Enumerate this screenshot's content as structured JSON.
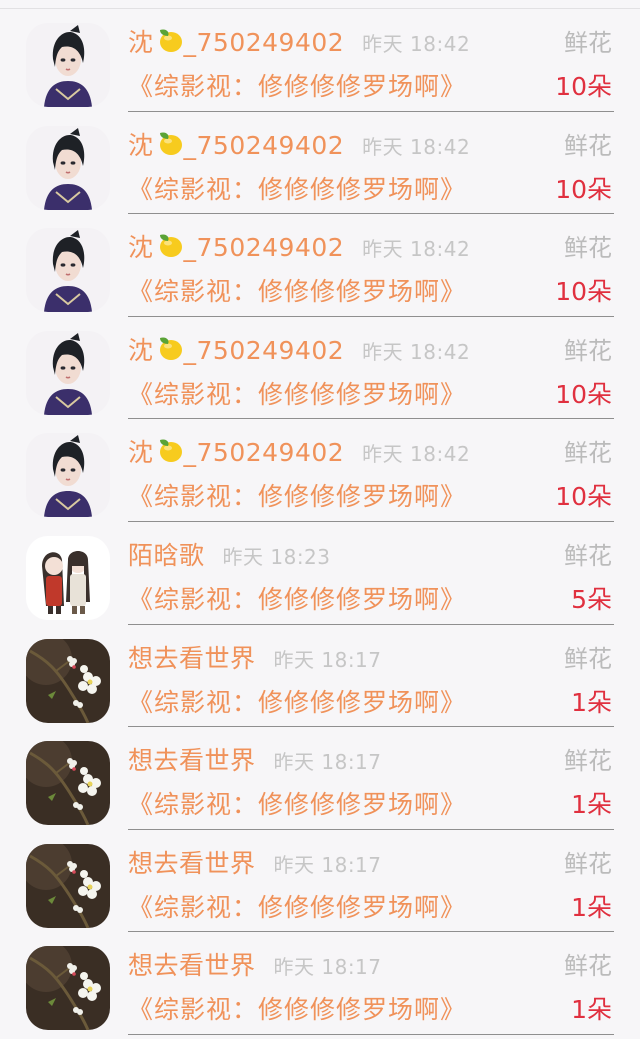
{
  "gift_list": [
    {
      "avatar": "ancient-man-avatar",
      "user_name": "沈",
      "has_lemon": true,
      "user_suffix": "_750249402",
      "time": "昨天 18:42",
      "gift_type": "鲜花",
      "book_title": "《综影视：修修修修罗场啊》",
      "count": "10朵"
    },
    {
      "avatar": "ancient-man-avatar",
      "user_name": "沈",
      "has_lemon": true,
      "user_suffix": "_750249402",
      "time": "昨天 18:42",
      "gift_type": "鲜花",
      "book_title": "《综影视：修修修修罗场啊》",
      "count": "10朵"
    },
    {
      "avatar": "ancient-man-avatar",
      "user_name": "沈",
      "has_lemon": true,
      "user_suffix": "_750249402",
      "time": "昨天 18:42",
      "gift_type": "鲜花",
      "book_title": "《综影视：修修修修罗场啊》",
      "count": "10朵"
    },
    {
      "avatar": "ancient-man-avatar",
      "user_name": "沈",
      "has_lemon": true,
      "user_suffix": "_750249402",
      "time": "昨天 18:42",
      "gift_type": "鲜花",
      "book_title": "《综影视：修修修修罗场啊》",
      "count": "10朵"
    },
    {
      "avatar": "ancient-man-avatar",
      "user_name": "沈",
      "has_lemon": true,
      "user_suffix": "_750249402",
      "time": "昨天 18:42",
      "gift_type": "鲜花",
      "book_title": "《综影视：修修修修罗场啊》",
      "count": "10朵"
    },
    {
      "avatar": "couple-chibi-avatar",
      "user_name": "陌晗歌",
      "has_lemon": false,
      "user_suffix": "",
      "time": "昨天 18:23",
      "gift_type": "鲜花",
      "book_title": "《综影视：修修修修罗场啊》",
      "count": "5朵"
    },
    {
      "avatar": "blossom-avatar",
      "user_name": "想去看世界",
      "has_lemon": false,
      "user_suffix": "",
      "time": "昨天 18:17",
      "gift_type": "鲜花",
      "book_title": "《综影视：修修修修罗场啊》",
      "count": "1朵"
    },
    {
      "avatar": "blossom-avatar",
      "user_name": "想去看世界",
      "has_lemon": false,
      "user_suffix": "",
      "time": "昨天 18:17",
      "gift_type": "鲜花",
      "book_title": "《综影视：修修修修罗场啊》",
      "count": "1朵"
    },
    {
      "avatar": "blossom-avatar",
      "user_name": "想去看世界",
      "has_lemon": false,
      "user_suffix": "",
      "time": "昨天 18:17",
      "gift_type": "鲜花",
      "book_title": "《综影视：修修修修罗场啊》",
      "count": "1朵"
    },
    {
      "avatar": "blossom-avatar",
      "user_name": "想去看世界",
      "has_lemon": false,
      "user_suffix": "",
      "time": "昨天 18:17",
      "gift_type": "鲜花",
      "book_title": "《综影视：修修修修罗场啊》",
      "count": "1朵"
    }
  ],
  "colors": {
    "name": "#f0925a",
    "count": "#e0303f",
    "muted": "#bbbbbb",
    "background": "#f7f6f8"
  }
}
